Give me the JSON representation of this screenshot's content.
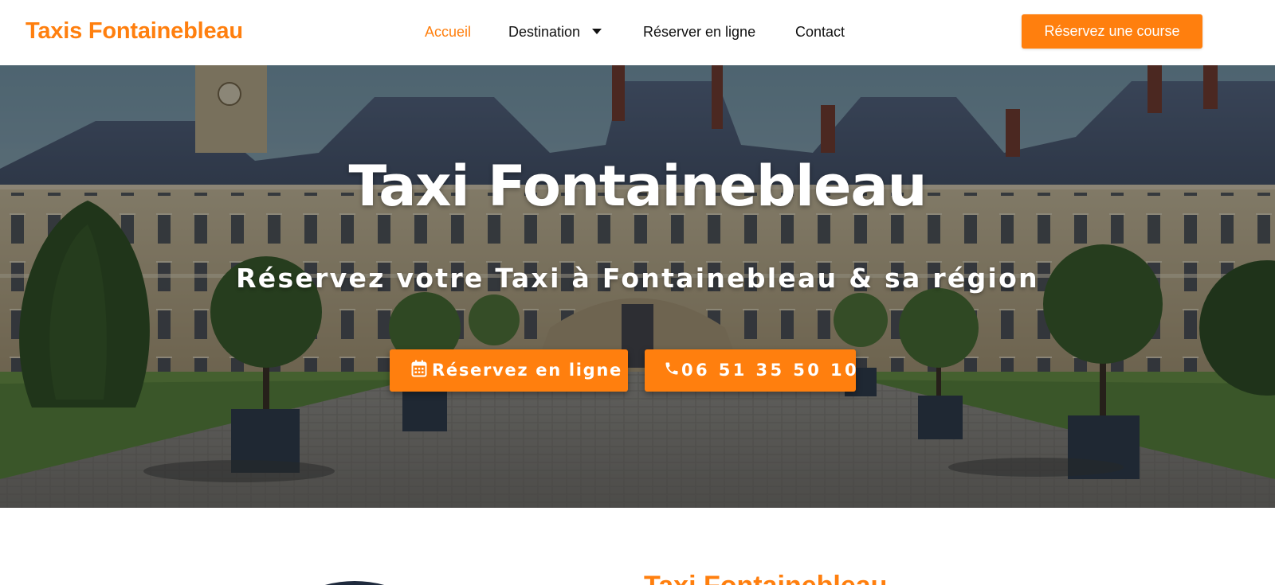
{
  "header": {
    "logo": "Taxis Fontainebleau",
    "nav": [
      {
        "label": "Accueil",
        "active": true
      },
      {
        "label": "Destination",
        "has_dropdown": true
      },
      {
        "label": "Réserver en ligne"
      },
      {
        "label": "Contact"
      }
    ],
    "cta_label": "Réservez une course"
  },
  "hero": {
    "title": "Taxi Fontainebleau",
    "subtitle": "Réservez votre Taxi à Fontainebleau & sa région",
    "btn_online": {
      "icon": "calendar-icon",
      "label": "Réservez en ligne"
    },
    "btn_phone": {
      "icon": "phone-icon",
      "label": "06 51 35 50 10"
    }
  },
  "section": {
    "title": "Taxi Fontainebleau"
  },
  "colors": {
    "accent": "#ff7f0e",
    "text": "#111111",
    "white": "#ffffff"
  }
}
